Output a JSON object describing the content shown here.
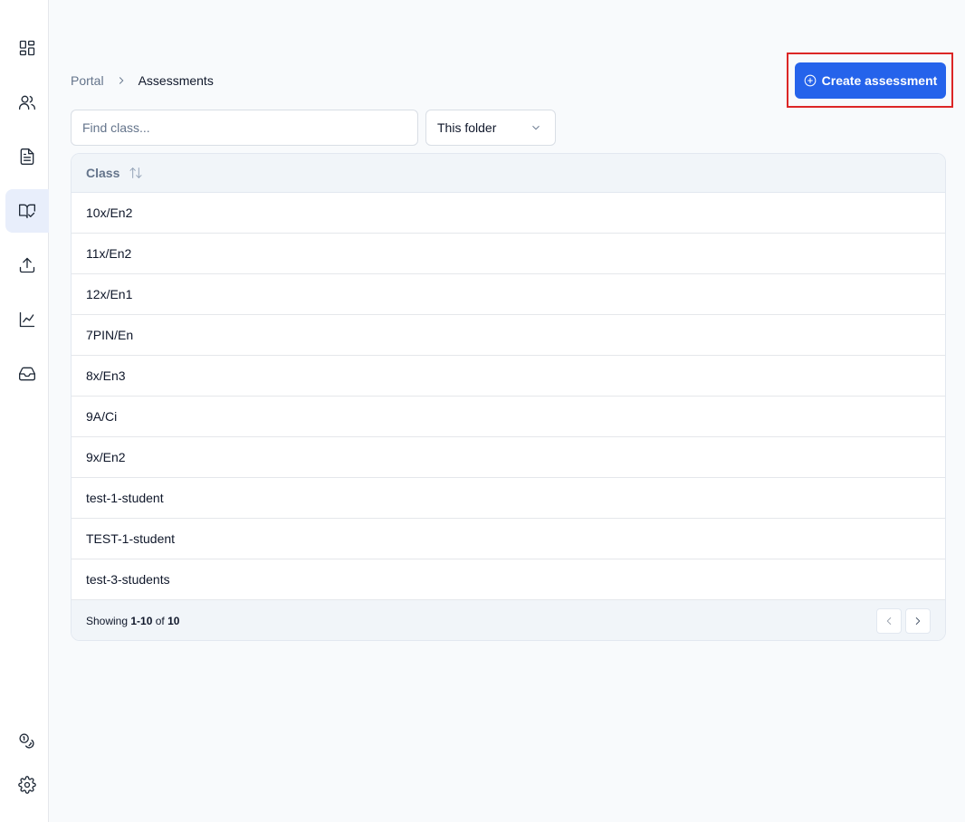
{
  "sidebar": {
    "items": [
      {
        "icon": "dashboard-icon",
        "active": false
      },
      {
        "icon": "users-icon",
        "active": false
      },
      {
        "icon": "document-icon",
        "active": false
      },
      {
        "icon": "book-check-icon",
        "active": true
      },
      {
        "icon": "upload-icon",
        "active": false
      },
      {
        "icon": "chart-line-icon",
        "active": false
      },
      {
        "icon": "inbox-icon",
        "active": false
      }
    ],
    "bottom_items": [
      {
        "icon": "coins-icon"
      },
      {
        "icon": "gear-icon"
      }
    ]
  },
  "breadcrumb": {
    "root": "Portal",
    "current": "Assessments"
  },
  "toolbar": {
    "create_label": "Create assessment"
  },
  "filters": {
    "search_placeholder": "Find class...",
    "search_value": "",
    "folder_selected": "This folder"
  },
  "table": {
    "column_header": "Class",
    "rows": [
      "10x/En2",
      "11x/En2",
      "12x/En1",
      "7PIN/En",
      "8x/En3",
      "9A/Ci",
      "9x/En2",
      "test-1-student",
      "TEST-1-student",
      "test-3-students"
    ],
    "footer": {
      "showing_prefix": "Showing",
      "range": "1-10",
      "of_word": "of",
      "total": "10"
    }
  },
  "colors": {
    "primary": "#2563eb",
    "highlight": "#dc2626",
    "active_nav_bg": "#e8eefb"
  }
}
